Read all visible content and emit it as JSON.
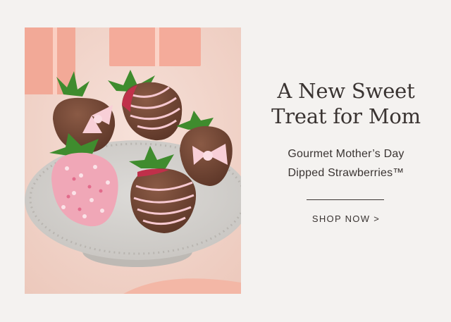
{
  "banner": {
    "headline_line1": "A New Sweet",
    "headline_line2": "Treat for Mom",
    "sub_line1": "Gourmet Mother’s Day",
    "sub_line2": "Dipped Strawberries™",
    "cta_label": "SHOP NOW >"
  },
  "colors": {
    "background": "#f4f2f0",
    "text": "#3a3432",
    "chocolate": "#6a4030",
    "pink_drizzle": "#f6c8d0"
  },
  "icons": {
    "product_image": "chocolate-dipped-strawberries-photo"
  }
}
